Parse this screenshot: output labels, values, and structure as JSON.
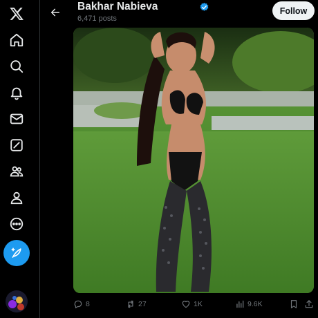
{
  "sidebar": {
    "items": [
      {
        "icon": "x-logo-icon",
        "name": "x-logo"
      },
      {
        "icon": "home-icon",
        "name": "home"
      },
      {
        "icon": "search-icon",
        "name": "explore"
      },
      {
        "icon": "bell-icon",
        "name": "notifications"
      },
      {
        "icon": "mail-icon",
        "name": "messages"
      },
      {
        "icon": "grok-icon",
        "name": "grok"
      },
      {
        "icon": "communities-icon",
        "name": "communities"
      },
      {
        "icon": "profile-icon",
        "name": "profile"
      },
      {
        "icon": "more-icon",
        "name": "more"
      }
    ],
    "compose_icon": "compose-feather-icon"
  },
  "header": {
    "name": "Bakhar Nabieva",
    "posts_count": "6,471 posts",
    "follow_label": "Follow"
  },
  "actions": {
    "replies": "8",
    "reposts": "27",
    "likes": "1K",
    "views": "9.6K"
  },
  "colors": {
    "accent": "#1d9bf0",
    "background": "#000000",
    "text": "#e7e9ea",
    "muted": "#71767b"
  }
}
